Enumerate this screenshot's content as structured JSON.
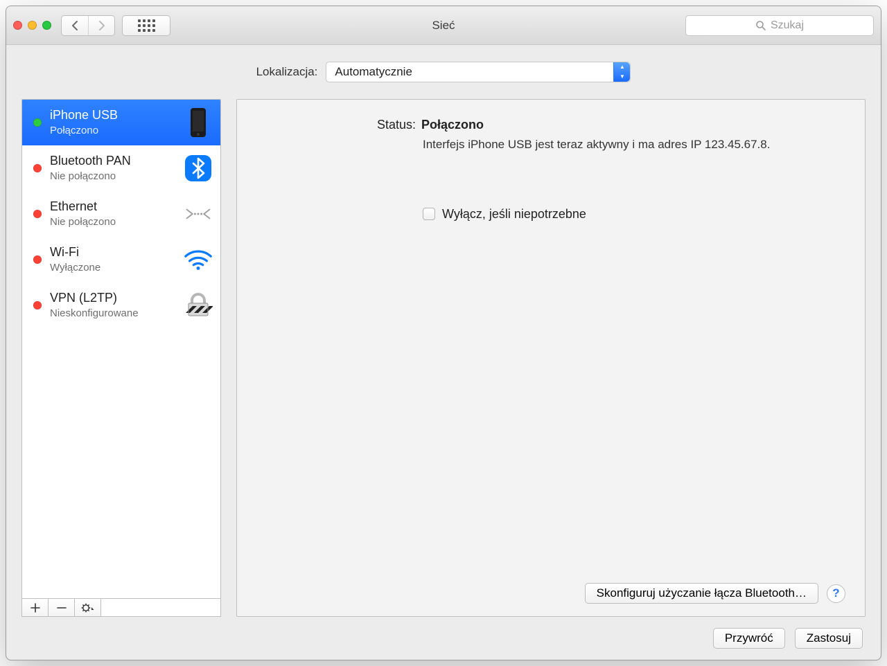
{
  "window": {
    "title": "Sieć"
  },
  "search": {
    "placeholder": "Szukaj"
  },
  "location": {
    "label": "Lokalizacja:",
    "value": "Automatycznie"
  },
  "status_colors": {
    "ok": "#2ecc40",
    "bad": "#ff4136"
  },
  "sidebar": {
    "items": [
      {
        "name": "iPhone USB",
        "status": "Połączono",
        "icon": "iphone",
        "state": "ok",
        "selected": true
      },
      {
        "name": "Bluetooth PAN",
        "status": "Nie połączono",
        "icon": "bluetooth",
        "state": "bad",
        "selected": false
      },
      {
        "name": "Ethernet",
        "status": "Nie połączono",
        "icon": "ethernet",
        "state": "bad",
        "selected": false
      },
      {
        "name": "Wi-Fi",
        "status": "Wyłączone",
        "icon": "wifi",
        "state": "bad",
        "selected": false
      },
      {
        "name": "VPN (L2TP)",
        "status": "Nieskonfigurowane",
        "icon": "vpn",
        "state": "bad",
        "selected": false
      }
    ]
  },
  "detail": {
    "status_label": "Status:",
    "status_value": "Połączono",
    "description": "Interfejs iPhone USB  jest teraz aktywny i ma adres IP 123.45.67.8.",
    "checkbox_label": "Wyłącz, jeśli niepotrzebne",
    "checkbox_checked": false,
    "configure_button": "Skonfiguruj użyczanie łącza Bluetooth…"
  },
  "buttons": {
    "revert": "Przywróć",
    "apply": "Zastosuj"
  }
}
